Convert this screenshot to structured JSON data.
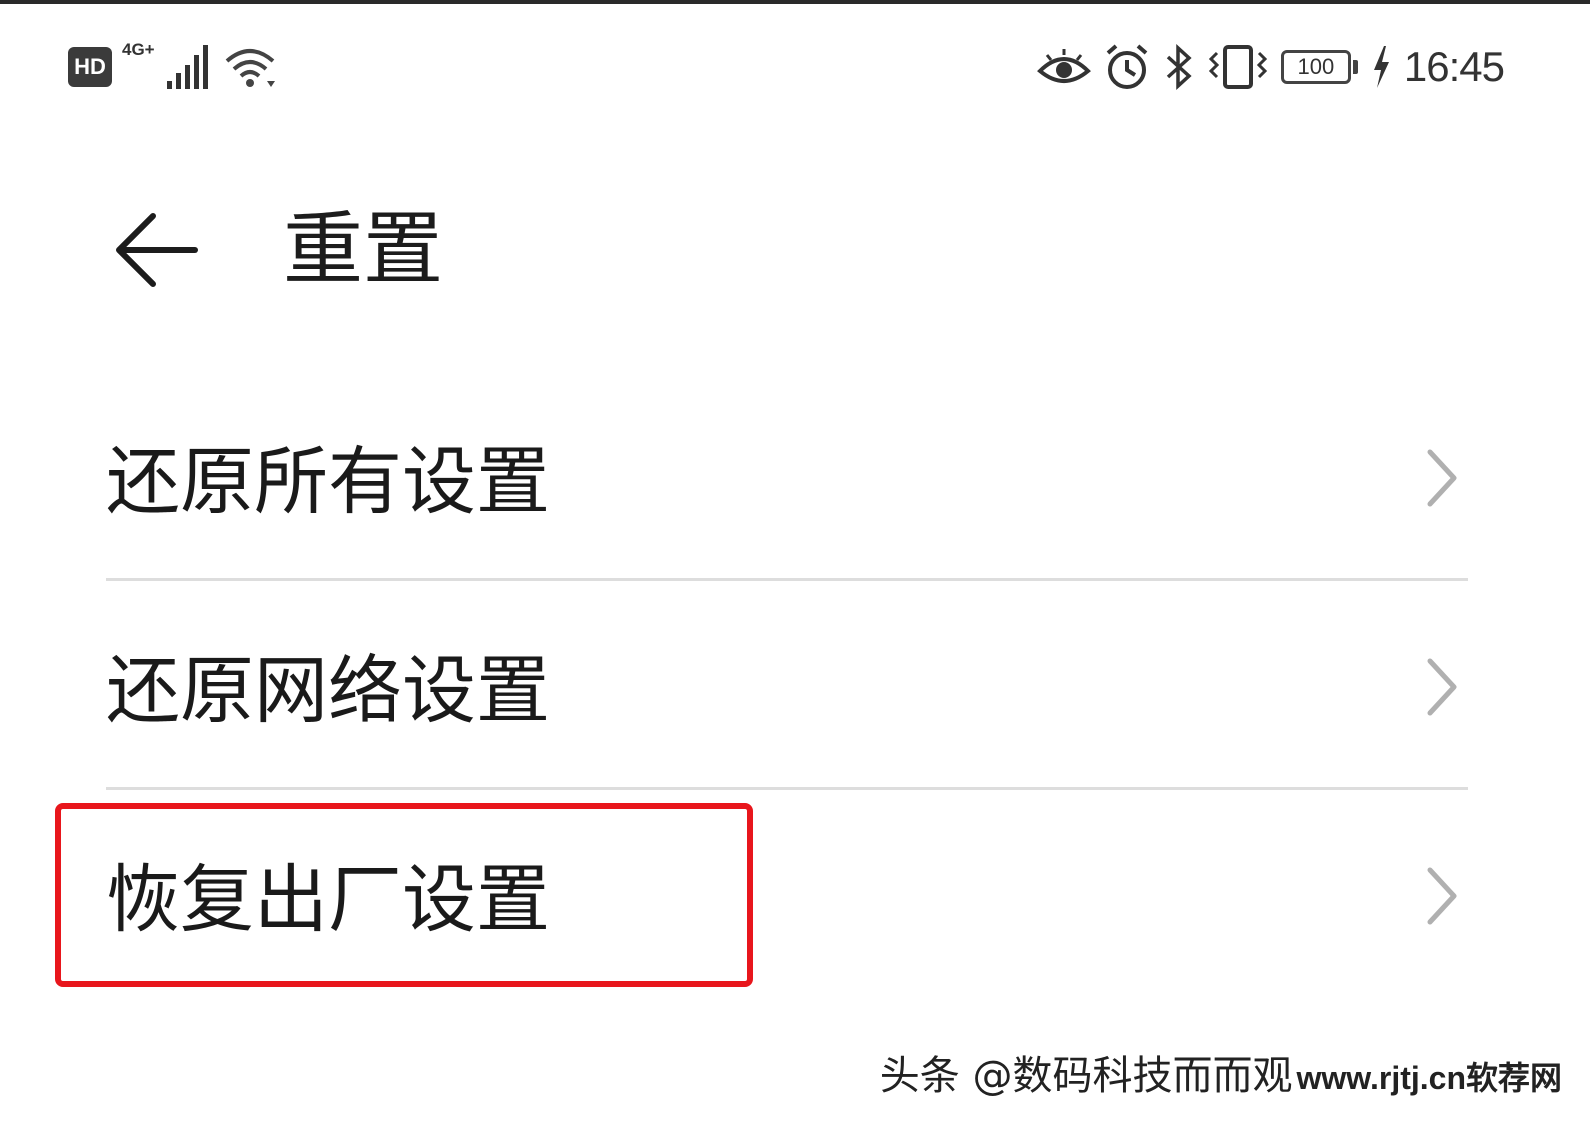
{
  "status_bar": {
    "hd_badge": "HD",
    "network_type": "4G+",
    "battery_level": "100",
    "time": "16:45",
    "icons": [
      "signal-icon",
      "wifi-icon",
      "eye-comfort-icon",
      "alarm-icon",
      "bluetooth-icon",
      "vibrate-icon",
      "battery-icon",
      "charging-icon"
    ]
  },
  "app_bar": {
    "back_icon": "back-arrow-icon",
    "title": "重置"
  },
  "list": {
    "items": [
      {
        "label": "还原所有设置",
        "icon": "chevron-right-icon"
      },
      {
        "label": "还原网络设置",
        "icon": "chevron-right-icon"
      },
      {
        "label": "恢复出厂设置",
        "icon": "chevron-right-icon",
        "highlighted": true
      }
    ]
  },
  "annotation": {
    "highlight_color": "#e8161c"
  },
  "watermark": {
    "text": "头条 @数码科技而而观",
    "url": "www.rjtj.cn软荐网"
  },
  "colors": {
    "background": "#ffffff",
    "text": "#1a1a1a",
    "divider": "#dddddd",
    "chevron": "#b0b0b0"
  }
}
